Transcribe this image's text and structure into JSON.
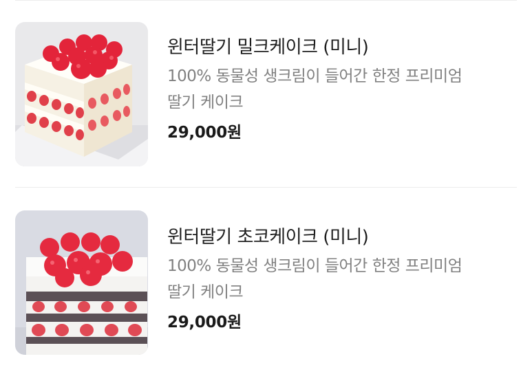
{
  "products": [
    {
      "name": "윈터딸기 밀크케이크 (미니)",
      "description_line1": "100% 동물성 생크림이 들어간 한정 프리미엄",
      "description_line2": "딸기 케이크",
      "price": "29,000원",
      "image": "strawberry-milk-cake-photo"
    },
    {
      "name": "윈터딸기 초코케이크 (미니)",
      "description_line1": "100% 동물성 생크림이 들어간 한정 프리미엄",
      "description_line2": "딸기 케이크",
      "price": "29,000원",
      "image": "strawberry-choco-cake-photo"
    }
  ],
  "colors": {
    "title": "#1e1e1e",
    "description": "#808080",
    "price": "#1a1a1a",
    "divider": "#ececec"
  }
}
